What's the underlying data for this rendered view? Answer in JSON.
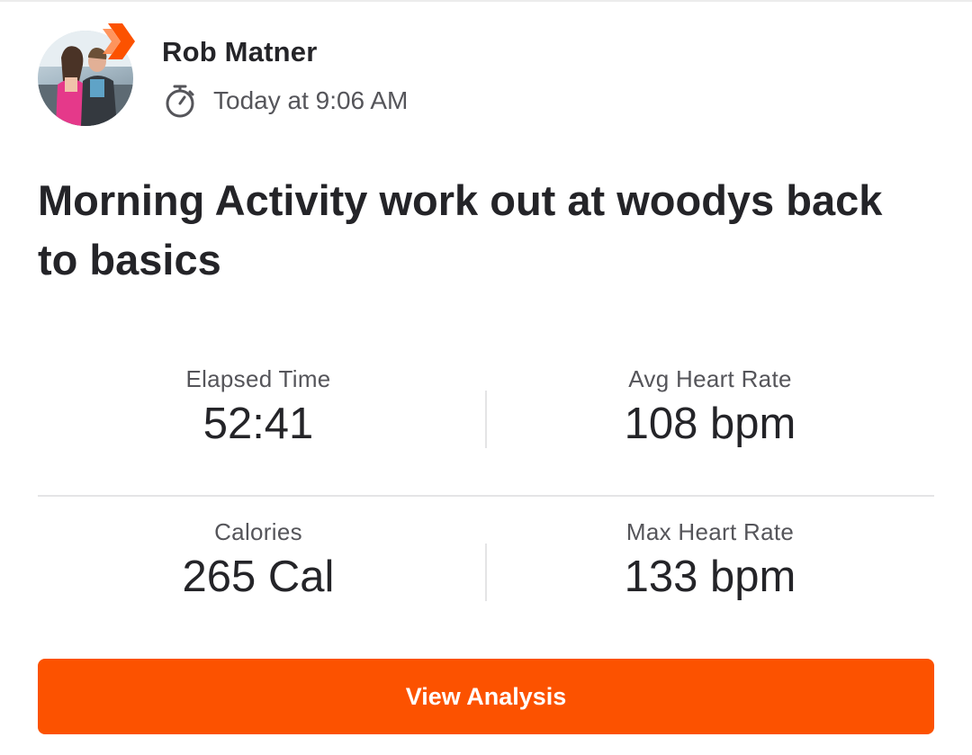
{
  "athlete": {
    "name": "Rob Matner",
    "avatar_icon": "profile-photo",
    "badge_icon": "subscriber-chevron-badge"
  },
  "activity": {
    "timestamp": "Today at 9:06 AM",
    "timestamp_icon": "stopwatch-icon",
    "title": "Morning Activity work out at woodys back to basics"
  },
  "stats": [
    {
      "label": "Elapsed Time",
      "value": "52:41"
    },
    {
      "label": "Avg Heart Rate",
      "value": "108 bpm"
    },
    {
      "label": "Calories",
      "value": "265 Cal"
    },
    {
      "label": "Max Heart Rate",
      "value": "133 bpm"
    }
  ],
  "actions": {
    "view_analysis_label": "View Analysis"
  },
  "colors": {
    "accent": "#fc5200",
    "text_primary": "#242428",
    "text_secondary": "#55555a",
    "divider": "#e4e4e6"
  }
}
